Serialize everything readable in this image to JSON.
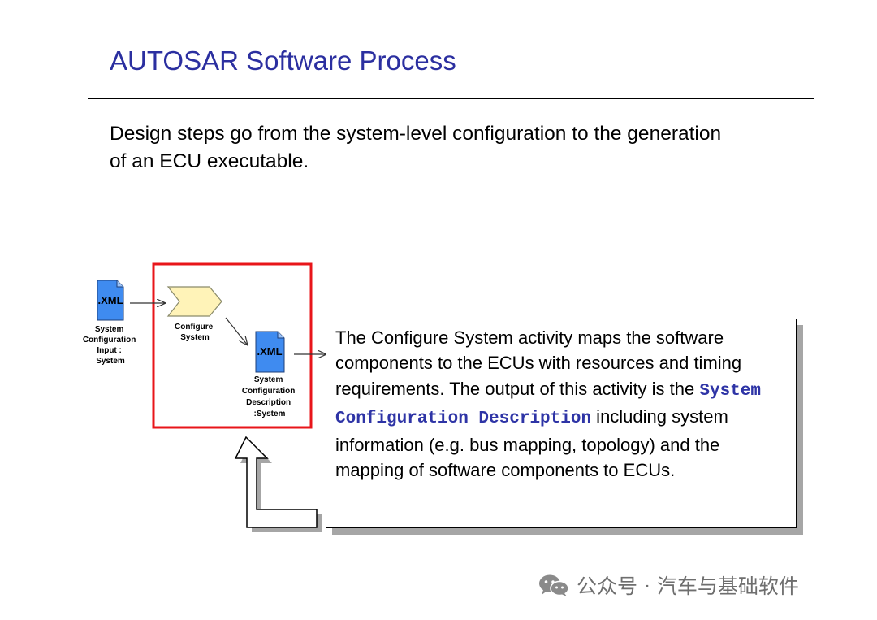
{
  "slide": {
    "title": "AUTOSAR Software Process",
    "intro": "Design steps go from the system-level configuration to the generation of an ECU executable."
  },
  "diagram": {
    "input_doc": {
      "tag": ".XML",
      "label_lines": [
        "System",
        "Configuration",
        "Input :",
        "System"
      ]
    },
    "activity": {
      "label_lines": [
        "Configure",
        "System"
      ]
    },
    "output_doc": {
      "tag": ".XML",
      "label_lines": [
        "System",
        "Configuration",
        "Description",
        ":System"
      ]
    },
    "colors": {
      "doc_fill": "#3f8bf0",
      "activity_fill": "#fff3b8",
      "highlight_border": "#e8151a",
      "title": "#2b2fa0",
      "code": "#2e34a6"
    }
  },
  "callout": {
    "text_before": "The Configure System activity maps the software components to the ECUs with resources and timing requirements. The output of this activity is the ",
    "code": "System Configuration Description",
    "text_after": " including system information (e.g. bus mapping, topology) and the mapping of software components to ECUs."
  },
  "watermark": {
    "text": "公众号 · 汽车与基础软件",
    "icon": "wechat-icon"
  }
}
